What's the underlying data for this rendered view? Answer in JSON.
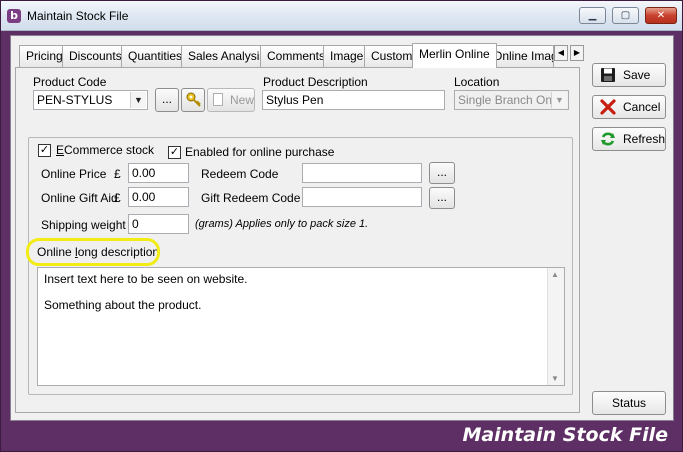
{
  "window": {
    "title": "Maintain Stock File",
    "app_icon_letter": "b",
    "footer_title": "Maintain Stock File"
  },
  "tabs": [
    {
      "label": "Pricing"
    },
    {
      "label": "Discounts"
    },
    {
      "label": "Quantities"
    },
    {
      "label": "Sales Analysis"
    },
    {
      "label": "Comments"
    },
    {
      "label": "Image"
    },
    {
      "label": "Custom"
    },
    {
      "label": "Merlin Online",
      "active": true
    },
    {
      "label": "Online Image"
    }
  ],
  "product": {
    "code_label": "Product Code",
    "code_value": "PEN-STYLUS",
    "lookup_label": "...",
    "new_label": "New",
    "description_label": "Product Description",
    "description_value": "Stylus Pen",
    "location_label": "Location",
    "location_value": "Single Branch Only"
  },
  "online": {
    "ecommerce_label_prefix": "E",
    "ecommerce_label_rest": "Commerce stock",
    "ecommerce_checked": true,
    "enabled_label": "Enabled for online purchase",
    "enabled_checked": true,
    "online_price_label": "Online Price",
    "currency_symbol": "£",
    "online_price_value": "0.00",
    "gift_aid_label": "Online Gift Aid",
    "gift_aid_value": "0.00",
    "redeem_code_label": "Redeem Code",
    "redeem_code_value": "",
    "gift_redeem_code_label": "Gift Redeem Code",
    "gift_redeem_code_value": "",
    "ellipsis_label": "...",
    "shipping_weight_label": "Shipping weight",
    "shipping_weight_value": "0",
    "shipping_note": "(grams)  Applies only to pack size 1.",
    "long_desc_label_a": "Online ",
    "long_desc_label_u": "l",
    "long_desc_label_b": "ong description",
    "long_desc_line1": "Insert text here to be seen on website.",
    "long_desc_line2": "Something about the product."
  },
  "sidebar": {
    "save_label": "Save",
    "cancel_label": "Cancel",
    "refresh_label": "Refresh",
    "status_label": "Status"
  },
  "colors": {
    "frame": "#5e2f64",
    "highlight": "#f2ec14"
  }
}
